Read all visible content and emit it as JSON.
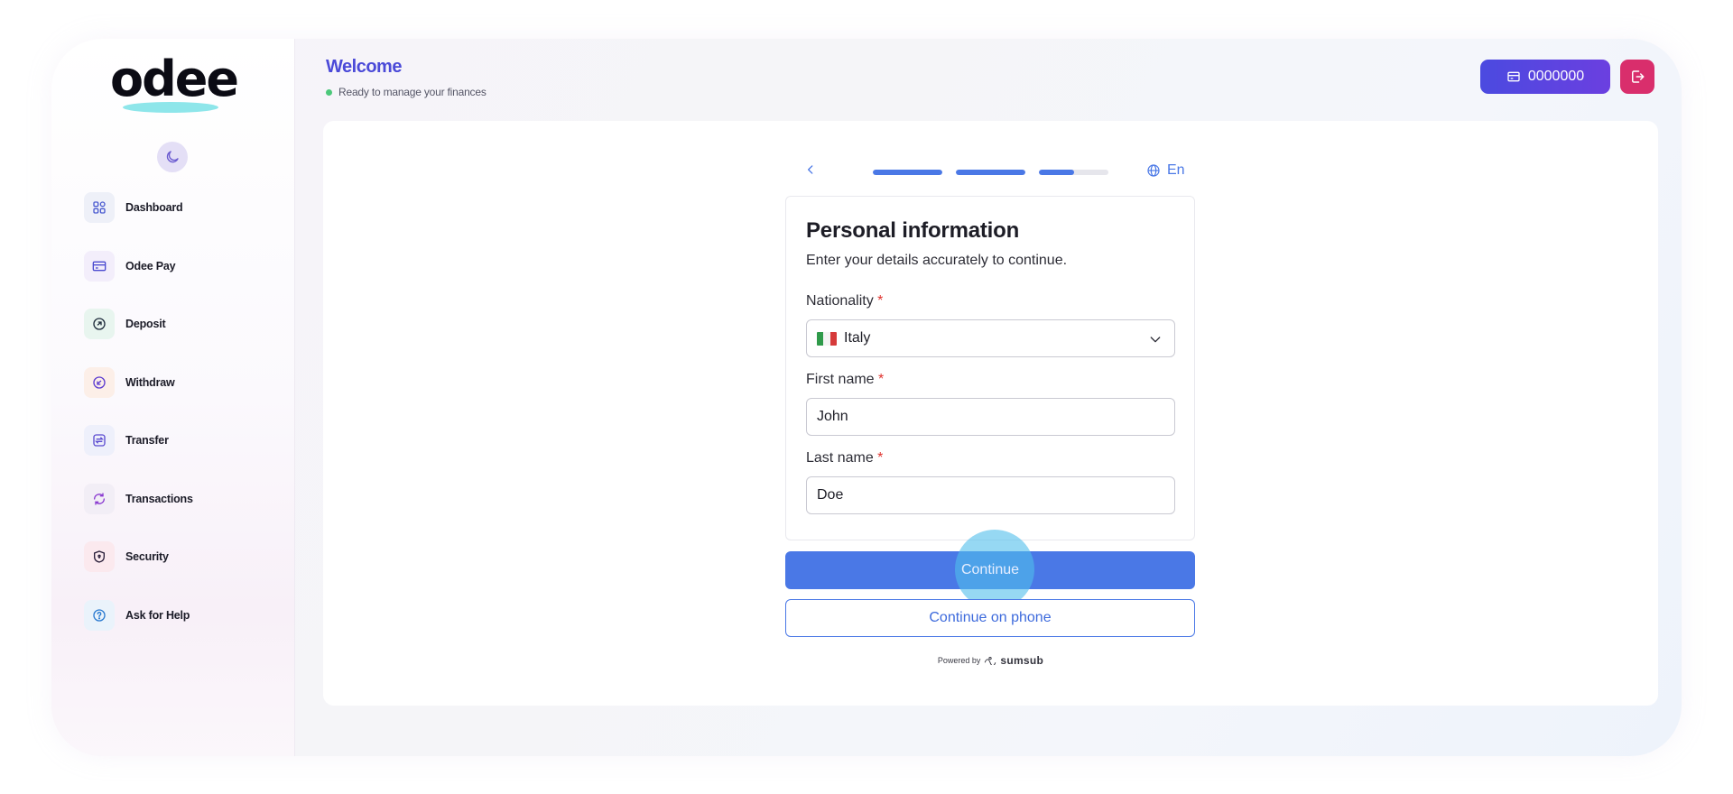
{
  "app": {
    "logo_text": "odee",
    "header": {
      "title": "Welcome",
      "subtitle": "Ready to manage your finances"
    },
    "account_number": "0000000"
  },
  "sidebar": {
    "items": [
      {
        "label": "Dashboard",
        "icon": "dashboard-icon",
        "bg": "#eef0f8",
        "color": "#4a5ad0"
      },
      {
        "label": "Odee Pay",
        "icon": "card-icon",
        "bg": "#f3eefb",
        "color": "#4a4ad0"
      },
      {
        "label": "Deposit",
        "icon": "deposit-icon",
        "bg": "#e8f5ef",
        "color": "#1d2a3a"
      },
      {
        "label": "Withdraw",
        "icon": "withdraw-icon",
        "bg": "#fcefe8",
        "color": "#5a3ad0"
      },
      {
        "label": "Transfer",
        "icon": "transfer-icon",
        "bg": "#eef0fb",
        "color": "#5a4ad0"
      },
      {
        "label": "Transactions",
        "icon": "refresh-icon",
        "bg": "#f2eef6",
        "color": "#8a3ad0"
      },
      {
        "label": "Security",
        "icon": "shield-icon",
        "bg": "#fbe9ee",
        "color": "#2a1f3a"
      },
      {
        "label": "Ask for Help",
        "icon": "help-icon",
        "bg": "#eaf3fb",
        "color": "#2a7ad0"
      }
    ]
  },
  "verification": {
    "language": "En",
    "progress": [
      1,
      1,
      0.5
    ],
    "title": "Personal information",
    "subtitle": "Enter your details accurately to continue.",
    "fields": {
      "nationality": {
        "label": "Nationality",
        "required_mark": "*",
        "value": "Italy"
      },
      "first_name": {
        "label": "First name",
        "required_mark": "*",
        "value": "John"
      },
      "last_name": {
        "label": "Last name",
        "required_mark": "*",
        "value": "Doe"
      }
    },
    "continue_label": "Continue",
    "continue_phone_label": "Continue on phone",
    "powered_by": "Powered by",
    "provider": "sumsub"
  },
  "colors": {
    "accent": "#4a78e6",
    "brand": "#4b4ad8",
    "logout": "#d92e6c"
  }
}
